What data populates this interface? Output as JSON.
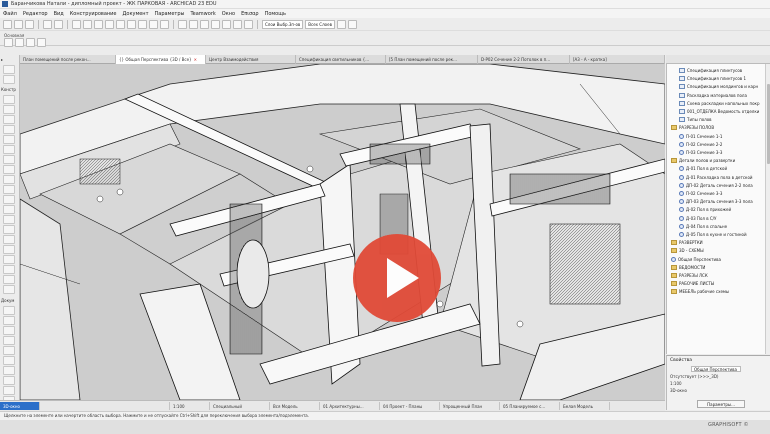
{
  "window": {
    "title": "Баранчикова Натали - дипломный проект - ЖК ПАРКОВАЯ - ARCHICAD 23 EDU"
  },
  "menu": [
    "Файл",
    "Редактор",
    "Вид",
    "Конструирование",
    "Документ",
    "Параметры",
    "Teamwork",
    "Окно",
    "Επισαρ",
    "Помощь"
  ],
  "toolbar": {
    "layer_combo": "Слои Выбр.3п-ов",
    "all_layers": "Всех Слоев"
  },
  "info_box": {
    "label": "Основная"
  },
  "tabs": [
    {
      "label": "План помещений после рекон...",
      "active": false
    },
    {
      "label": "{} Общая Перспектива {3D / Все}",
      "active": true
    },
    {
      "label": "Центр Взаимодействия",
      "active": false
    },
    {
      "label": "Спецификация светильников {...",
      "active": false
    },
    {
      "label": "[5 План помещений после рек...",
      "active": false
    },
    {
      "label": "D-P02 Сечение 2-2 Потолок в п...",
      "active": false
    },
    {
      "label": "[А3 - А - кратка]",
      "active": false
    }
  ],
  "toolbox": {
    "section_construct": "Констр",
    "section_document": "Докум"
  },
  "navigator": {
    "items": [
      {
        "label": "Спецификация плинтусов",
        "type": "doc",
        "indent": 1
      },
      {
        "label": "Спецификация плинтусов 1",
        "type": "doc",
        "indent": 1
      },
      {
        "label": "Спецификация молдингов и карн",
        "type": "doc",
        "indent": 1
      },
      {
        "label": "Раскладка материалов пола",
        "type": "doc",
        "indent": 1
      },
      {
        "label": "Схема раскладки напольных покр",
        "type": "doc",
        "indent": 1
      },
      {
        "label": "001_ОТДЕЛКА Ведомость отделки",
        "type": "doc",
        "indent": 1
      },
      {
        "label": "Типы полов",
        "type": "doc",
        "indent": 1
      },
      {
        "label": "РАЗРЕЗЫ ПОЛОВ",
        "type": "folder",
        "indent": 0
      },
      {
        "label": "П-01 Сечение 1-1",
        "type": "view",
        "indent": 1
      },
      {
        "label": "П-02 Сечение 2-2",
        "type": "view",
        "indent": 1
      },
      {
        "label": "П-03 Сечение 3-3",
        "type": "view",
        "indent": 1
      },
      {
        "label": "Детали полов и развертки",
        "type": "folder",
        "indent": 0
      },
      {
        "label": "Д-01 Пол в детской",
        "type": "view",
        "indent": 1
      },
      {
        "label": "Д-01 Раскладка пола в детской",
        "type": "view",
        "indent": 1
      },
      {
        "label": "ДП-02 Деталь сечения 2-2 пола",
        "type": "view",
        "indent": 1
      },
      {
        "label": "П-02 Сечение 3-3",
        "type": "view",
        "indent": 1
      },
      {
        "label": "ДП-03 Деталь сечения 3-3 пола",
        "type": "view",
        "indent": 1
      },
      {
        "label": "Д-02 Пол в прихожей",
        "type": "view",
        "indent": 1
      },
      {
        "label": "Д-03 Пол в С/У",
        "type": "view",
        "indent": 1
      },
      {
        "label": "Д-04 Пол в спальне",
        "type": "view",
        "indent": 1
      },
      {
        "label": "Д-05 Пол в кухне и гостиной",
        "type": "view",
        "indent": 1
      },
      {
        "label": "РАЗВЕРТКИ",
        "type": "folder",
        "indent": 0
      },
      {
        "label": "3D - СХЕМЫ",
        "type": "folder",
        "indent": 0
      },
      {
        "label": "Общая Перспектива",
        "type": "view",
        "indent": 0
      },
      {
        "label": "ВЕДОМОСТИ",
        "type": "folder",
        "indent": 0
      },
      {
        "label": "РАЗРЕЗЫ ЛСК",
        "type": "folder",
        "indent": 0
      },
      {
        "label": "РАБОЧИЕ ЛИСТЫ",
        "type": "folder",
        "indent": 0
      },
      {
        "label": "МЕБЕЛЬ рабочие схемы",
        "type": "folder",
        "indent": 0
      }
    ]
  },
  "properties": {
    "header": "Свойства",
    "name_value": "Общая Перспектива",
    "rows": [
      "Отсутствует (>>>_3D)",
      "1:100",
      "3D-окно"
    ],
    "params_button": "Параметры..."
  },
  "statusbar": {
    "cells": [
      "3D-окно",
      "1:100",
      "Специальный",
      "Вся Модель",
      "01 Архитектурны...",
      "04 Проект - Планы",
      "Упрощенный План",
      "05 Планируемое с...",
      "Белая Модель"
    ]
  },
  "hint": "Щелкните на элементе или начертите область выбора. Нажмите и не отпускайте Ctrl+Shift для переключения выбора элемента/подэлемента.",
  "watermark": "GRAPHISOFT ©",
  "icons": [
    "app-icon",
    "play-icon"
  ],
  "colors": {
    "play_button": "#e04a37",
    "accent_status": "#2b6fc9"
  }
}
